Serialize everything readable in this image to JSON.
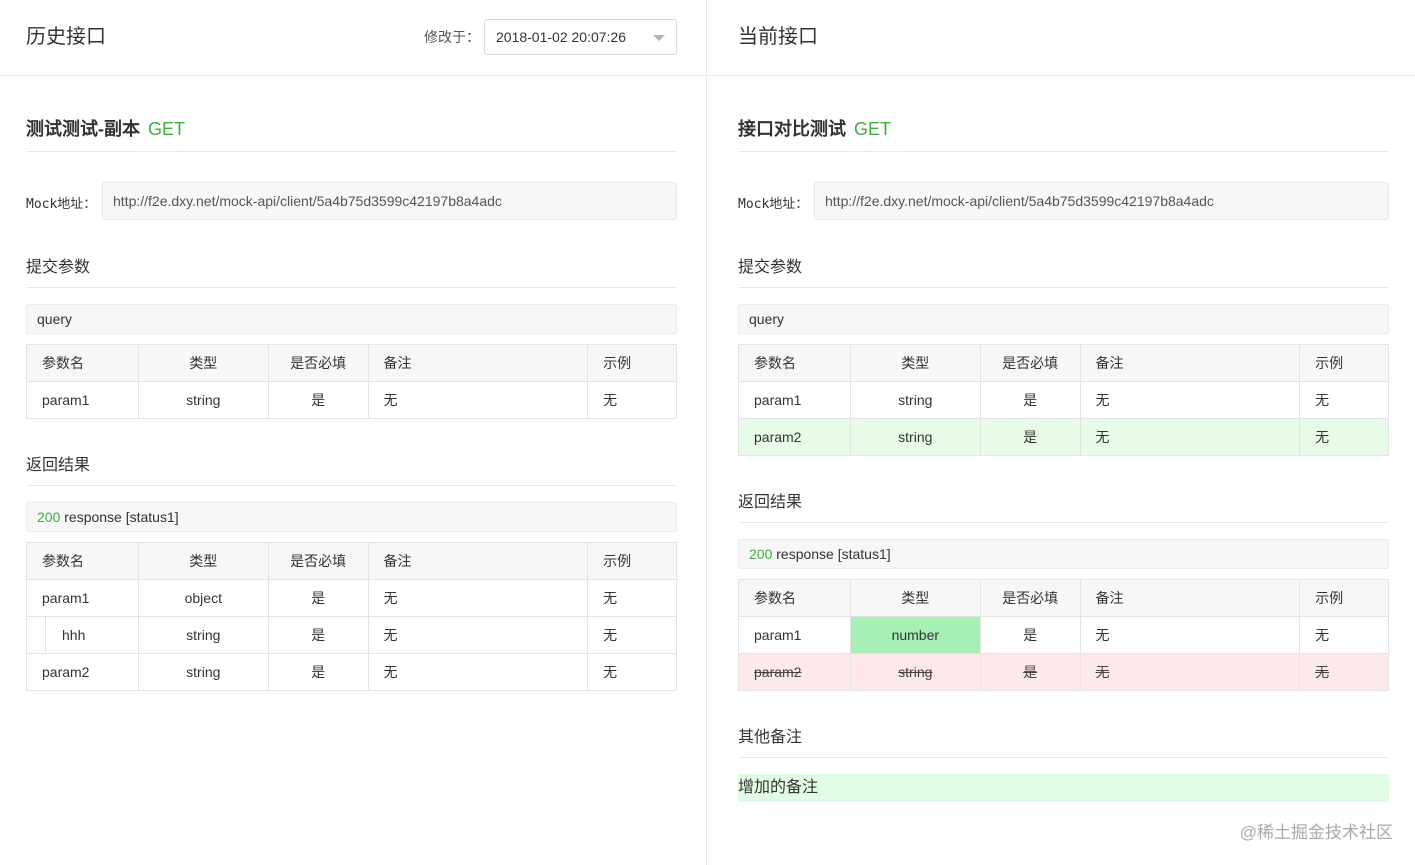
{
  "left": {
    "title": "历史接口",
    "modified_label": "修改于：",
    "version_selected": "2018-01-02 20:07:26",
    "api_name": "测试测试-副本",
    "method": "GET",
    "mock_label": "Mock地址：",
    "mock_url": "http://f2e.dxy.net/mock-api/client/5a4b75d3599c42197b8a4adc",
    "request_title": "提交参数",
    "request_sub": "query",
    "columns": [
      "参数名",
      "类型",
      "是否必填",
      "备注",
      "示例"
    ],
    "request_rows": [
      {
        "name": "param1",
        "type": "string",
        "required": "是",
        "note": "无",
        "example": "无"
      }
    ],
    "response_title": "返回结果",
    "response_code": "200",
    "response_text": " response [status1]",
    "response_rows": [
      {
        "name": "param1",
        "type": "object",
        "required": "是",
        "note": "无",
        "example": "无"
      },
      {
        "name": "hhh",
        "type": "string",
        "required": "是",
        "note": "无",
        "example": "无"
      },
      {
        "name": "param2",
        "type": "string",
        "required": "是",
        "note": "无",
        "example": "无"
      }
    ]
  },
  "right": {
    "title": "当前接口",
    "api_name": "接口对比测试",
    "method": "GET",
    "mock_label": "Mock地址：",
    "mock_url": "http://f2e.dxy.net/mock-api/client/5a4b75d3599c42197b8a4adc",
    "request_title": "提交参数",
    "request_sub": "query",
    "columns": [
      "参数名",
      "类型",
      "是否必填",
      "备注",
      "示例"
    ],
    "request_rows": [
      {
        "name": "param1",
        "type": "string",
        "required": "是",
        "note": "无",
        "example": "无"
      },
      {
        "name": "param2",
        "type": "string",
        "required": "是",
        "note": "无",
        "example": "无",
        "diff": "added"
      }
    ],
    "response_title": "返回结果",
    "response_code": "200",
    "response_text": " response [status1]",
    "response_rows": [
      {
        "name": "param1",
        "type": "number",
        "required": "是",
        "note": "无",
        "example": "无",
        "diff": "type-changed"
      },
      {
        "name": "param2",
        "type": "string",
        "required": "是",
        "note": "无",
        "example": "无",
        "diff": "removed"
      }
    ],
    "other_title": "其他备注",
    "other_remark": "增加的备注"
  },
  "colors": {
    "method_green": "#3fae3f",
    "added_row": "#e8fbe8",
    "removed_row": "#fde9e9",
    "changed_cell": "#a6f0b5"
  },
  "watermark": "@稀土掘金技术社区"
}
